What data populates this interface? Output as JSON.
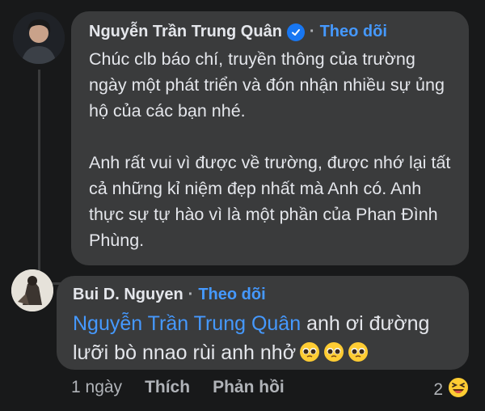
{
  "comment": {
    "author": "Nguyễn Trần Trung Quân",
    "separator": "·",
    "follow_label": "Theo dõi",
    "text": "Chúc clb báo chí, truyền thông của trường ngày một phát triển và đón nhận nhiều sự ủng hộ của các bạn nhé.\n\nAnh rất vui vì được về trường, được nhớ lại tất cả những kỉ niệm đẹp nhất mà Anh có. Anh thực sự tự hào vì là một phần của Phan Đình Phùng."
  },
  "reply": {
    "author": "Bui D. Nguyen",
    "separator": "·",
    "follow_label": "Theo dõi",
    "mention": "Nguyễn Trần Trung Quân",
    "text": " anh ơi đường lưỡi bò nnao rùi anh nhở",
    "emojis": [
      "pleading-face-emoji",
      "pleading-face-emoji",
      "pleading-face-emoji"
    ],
    "time": "1 ngày",
    "like_label": "Thích",
    "reply_label": "Phản hồi",
    "reaction_count": "2",
    "reaction_icon": "laughing-emoji"
  },
  "colors": {
    "background": "#18191a",
    "bubble": "#3a3b3c",
    "link": "#4599ff",
    "verified": "#1877f2"
  }
}
